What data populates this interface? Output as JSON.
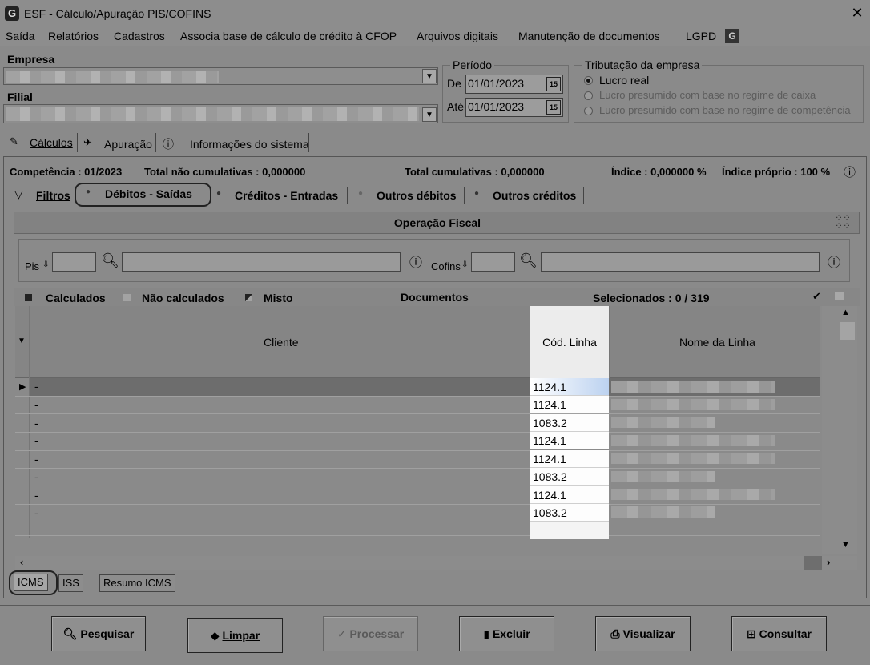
{
  "window": {
    "title": "ESF - Cálculo/Apuração PIS/COFINS",
    "logo_letter": "G",
    "close_glyph": "✕"
  },
  "menu": [
    "Saída",
    "Relatórios",
    "Cadastros",
    "Associa base de cálculo de crédito à CFOP",
    "Arquivos digitais",
    "Manutenção de documentos",
    "LGPD"
  ],
  "empresa": {
    "label": "Empresa",
    "value": ""
  },
  "filial": {
    "label": "Filial",
    "value": ""
  },
  "periodo": {
    "legend": "Período",
    "de_label": "De",
    "de_value": "01/01/2023",
    "ate_label": "Até",
    "ate_value": "01/01/2023",
    "cal_glyph": "15"
  },
  "tributacao": {
    "legend": "Tributação da empresa",
    "options": [
      "Lucro real",
      "Lucro presumido com base no regime de caixa",
      "Lucro presumido com base no regime de competência"
    ],
    "selected": "Lucro real"
  },
  "main_tabs": [
    "Cálculos",
    "Apuração",
    "Informações do sistema"
  ],
  "summary": {
    "competencia": "Competência : 01/2023",
    "total_nao_cumulativas": "Total não cumulativas : 0,000000",
    "total_cumulativas": "Total cumulativas : 0,000000",
    "indice": "Índice : 0,000000 %",
    "indice_proprio": "Índice próprio : 100 %"
  },
  "sub_tabs": [
    "Filtros",
    "Débitos - Saídas",
    "Créditos - Entradas",
    "Outros débitos",
    "Outros créditos"
  ],
  "operacao_fiscal": {
    "title": "Operação Fiscal",
    "pis_label": "Pis",
    "cofins_label": "Cofins",
    "pis_code": "",
    "pis_desc": "",
    "cofins_code": "",
    "cofins_desc": ""
  },
  "legend_bar": {
    "calculados": "Calculados",
    "nao_calculados": "Não calculados",
    "misto": "Misto",
    "documentos": "Documentos",
    "selecionados": "Selecionados : 0 / 319"
  },
  "grid": {
    "columns": [
      "Cliente",
      "Cód. Linha",
      "Nome da Linha"
    ],
    "rows": [
      {
        "cliente": "-",
        "cod_linha": "1124.1"
      },
      {
        "cliente": "-",
        "cod_linha": "1124.1"
      },
      {
        "cliente": "-",
        "cod_linha": "1083.2"
      },
      {
        "cliente": "-",
        "cod_linha": "1124.1"
      },
      {
        "cliente": "-",
        "cod_linha": "1124.1"
      },
      {
        "cliente": "-",
        "cod_linha": "1083.2"
      },
      {
        "cliente": "-",
        "cod_linha": "1124.1"
      },
      {
        "cliente": "-",
        "cod_linha": "1083.2"
      }
    ]
  },
  "bottom_tabs": [
    "ICMS",
    "ISS",
    "Resumo ICMS"
  ],
  "buttons": {
    "pesquisar": "Pesquisar",
    "limpar": "Limpar",
    "processar": "Processar",
    "excluir": "Excluir",
    "visualizar": "Visualizar",
    "consultar": "Consultar"
  }
}
